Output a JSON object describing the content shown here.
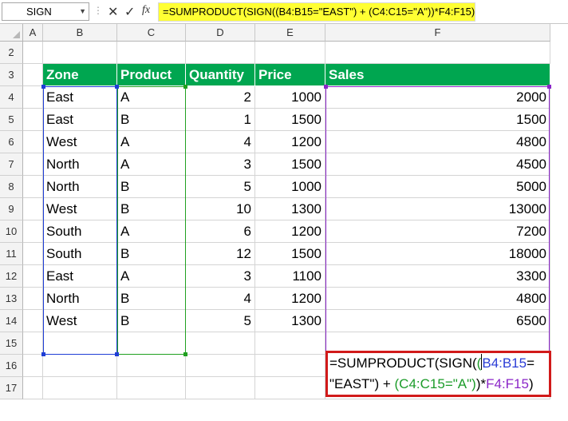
{
  "namebox": {
    "value": "SIGN"
  },
  "formula_bar": {
    "cancel_icon": "✕",
    "enter_icon": "✓",
    "fx_label": "fx",
    "formula": "=SUMPRODUCT(SIGN((B4:B15=\"EAST\") + (C4:C15=\"A\"))*F4:F15)"
  },
  "columns": [
    "A",
    "B",
    "C",
    "D",
    "E",
    "F"
  ],
  "rows": [
    "2",
    "3",
    "4",
    "5",
    "6",
    "7",
    "8",
    "9",
    "10",
    "11",
    "12",
    "13",
    "14",
    "15",
    "16",
    "17"
  ],
  "table": {
    "headers": [
      "Zone",
      "Product",
      "Quantity",
      "Price",
      "Sales"
    ],
    "rows": [
      [
        "East",
        "A",
        "2",
        "1000",
        "2000"
      ],
      [
        "East",
        "B",
        "1",
        "1500",
        "1500"
      ],
      [
        "West",
        "A",
        "4",
        "1200",
        "4800"
      ],
      [
        "North",
        "A",
        "3",
        "1500",
        "4500"
      ],
      [
        "North",
        "B",
        "5",
        "1000",
        "5000"
      ],
      [
        "West",
        "B",
        "10",
        "1300",
        "13000"
      ],
      [
        "South",
        "A",
        "6",
        "1200",
        "7200"
      ],
      [
        "South",
        "B",
        "12",
        "1500",
        "18000"
      ],
      [
        "East",
        "A",
        "3",
        "1100",
        "3300"
      ],
      [
        "North",
        "B",
        "4",
        "1200",
        "4800"
      ],
      [
        "West",
        "B",
        "5",
        "1300",
        "6500"
      ]
    ]
  },
  "formula_box": {
    "line1_a": "=SUMPRODUCT(SIGN(",
    "line1_paren_green": "(",
    "line1_range_blue": "B4:B15",
    "line1_eq": "=",
    "line2_text": "\"EAST\") + ",
    "line2_range_green": "(C4:C15=\"A\")",
    "line2_close": ")*",
    "line2_range_purple": "F4:F15",
    "line2_end": ")"
  },
  "colors": {
    "header_fill": "#00a650",
    "formula_bar_highlight": "#ffff33",
    "formula_box_border": "#d11a1a",
    "range_b": "#1f3ed6",
    "range_c": "#20a020",
    "range_f": "#8b26c8"
  }
}
